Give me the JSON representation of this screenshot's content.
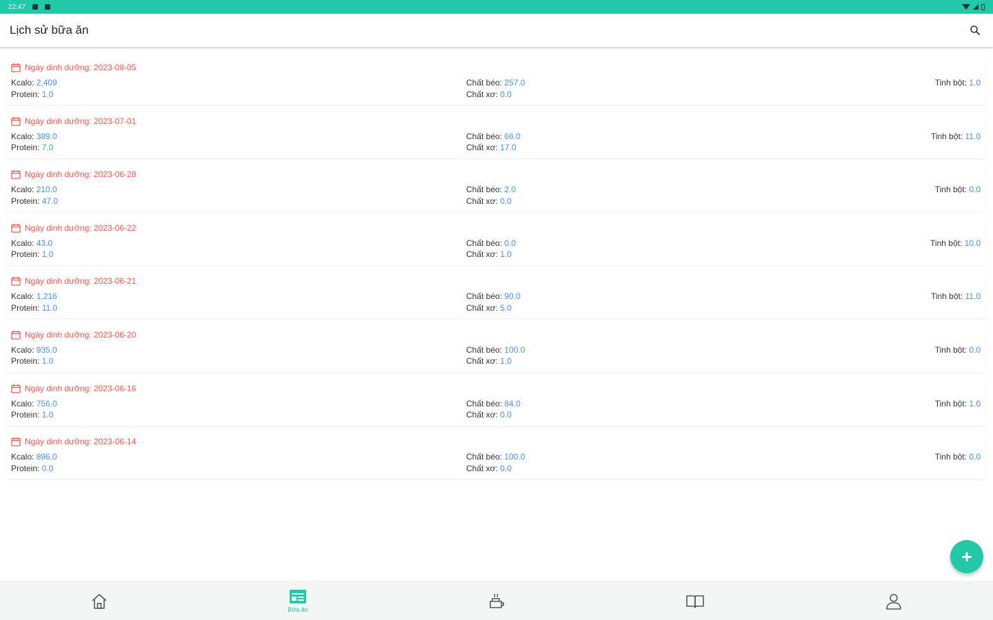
{
  "status_bar": {
    "time": "22:47"
  },
  "header": {
    "title": "Lịch sử bữa ăn"
  },
  "labels": {
    "date_prefix": "Ngày dinh dưỡng:",
    "kcal": "Kcalo:",
    "protein": "Protein:",
    "fat": "Chất béo:",
    "fiber": "Chất xơ:",
    "carb": "Tinh bột:"
  },
  "records": [
    {
      "date": "2023-08-05",
      "kcal": "2,409",
      "protein": "1.0",
      "fat": "257.0",
      "fiber": "0.0",
      "carb": "1.0"
    },
    {
      "date": "2023-07-01",
      "kcal": "389.0",
      "protein": "7.0",
      "fat": "66.0",
      "fiber": "17.0",
      "carb": "11.0"
    },
    {
      "date": "2023-06-28",
      "kcal": "210.0",
      "protein": "47.0",
      "fat": "2.0",
      "fiber": "0.0",
      "carb": "0.0"
    },
    {
      "date": "2023-06-22",
      "kcal": "43.0",
      "protein": "1.0",
      "fat": "0.0",
      "fiber": "1.0",
      "carb": "10.0"
    },
    {
      "date": "2023-06-21",
      "kcal": "1,216",
      "protein": "11.0",
      "fat": "90.0",
      "fiber": "5.0",
      "carb": "11.0"
    },
    {
      "date": "2023-06-20",
      "kcal": "935.0",
      "protein": "1.0",
      "fat": "100.0",
      "fiber": "1.0",
      "carb": "0.0"
    },
    {
      "date": "2023-06-16",
      "kcal": "756.0",
      "protein": "1.0",
      "fat": "84.0",
      "fiber": "0.0",
      "carb": "1.0"
    },
    {
      "date": "2023-06-14",
      "kcal": "896.0",
      "protein": "0.0",
      "fat": "100.0",
      "fiber": "0.0",
      "carb": "0.0"
    }
  ],
  "fab": {
    "label": "+"
  },
  "bottom_nav": [
    {
      "icon": "home-icon",
      "label": ""
    },
    {
      "icon": "meal-icon",
      "label": "Bữa ăn",
      "active": true
    },
    {
      "icon": "food-icon",
      "label": ""
    },
    {
      "icon": "book-icon",
      "label": ""
    },
    {
      "icon": "person-icon",
      "label": ""
    }
  ],
  "colors": {
    "accent": "#22c9a8",
    "date_red": "#f0574e",
    "value_blue": "#4a90e2"
  }
}
